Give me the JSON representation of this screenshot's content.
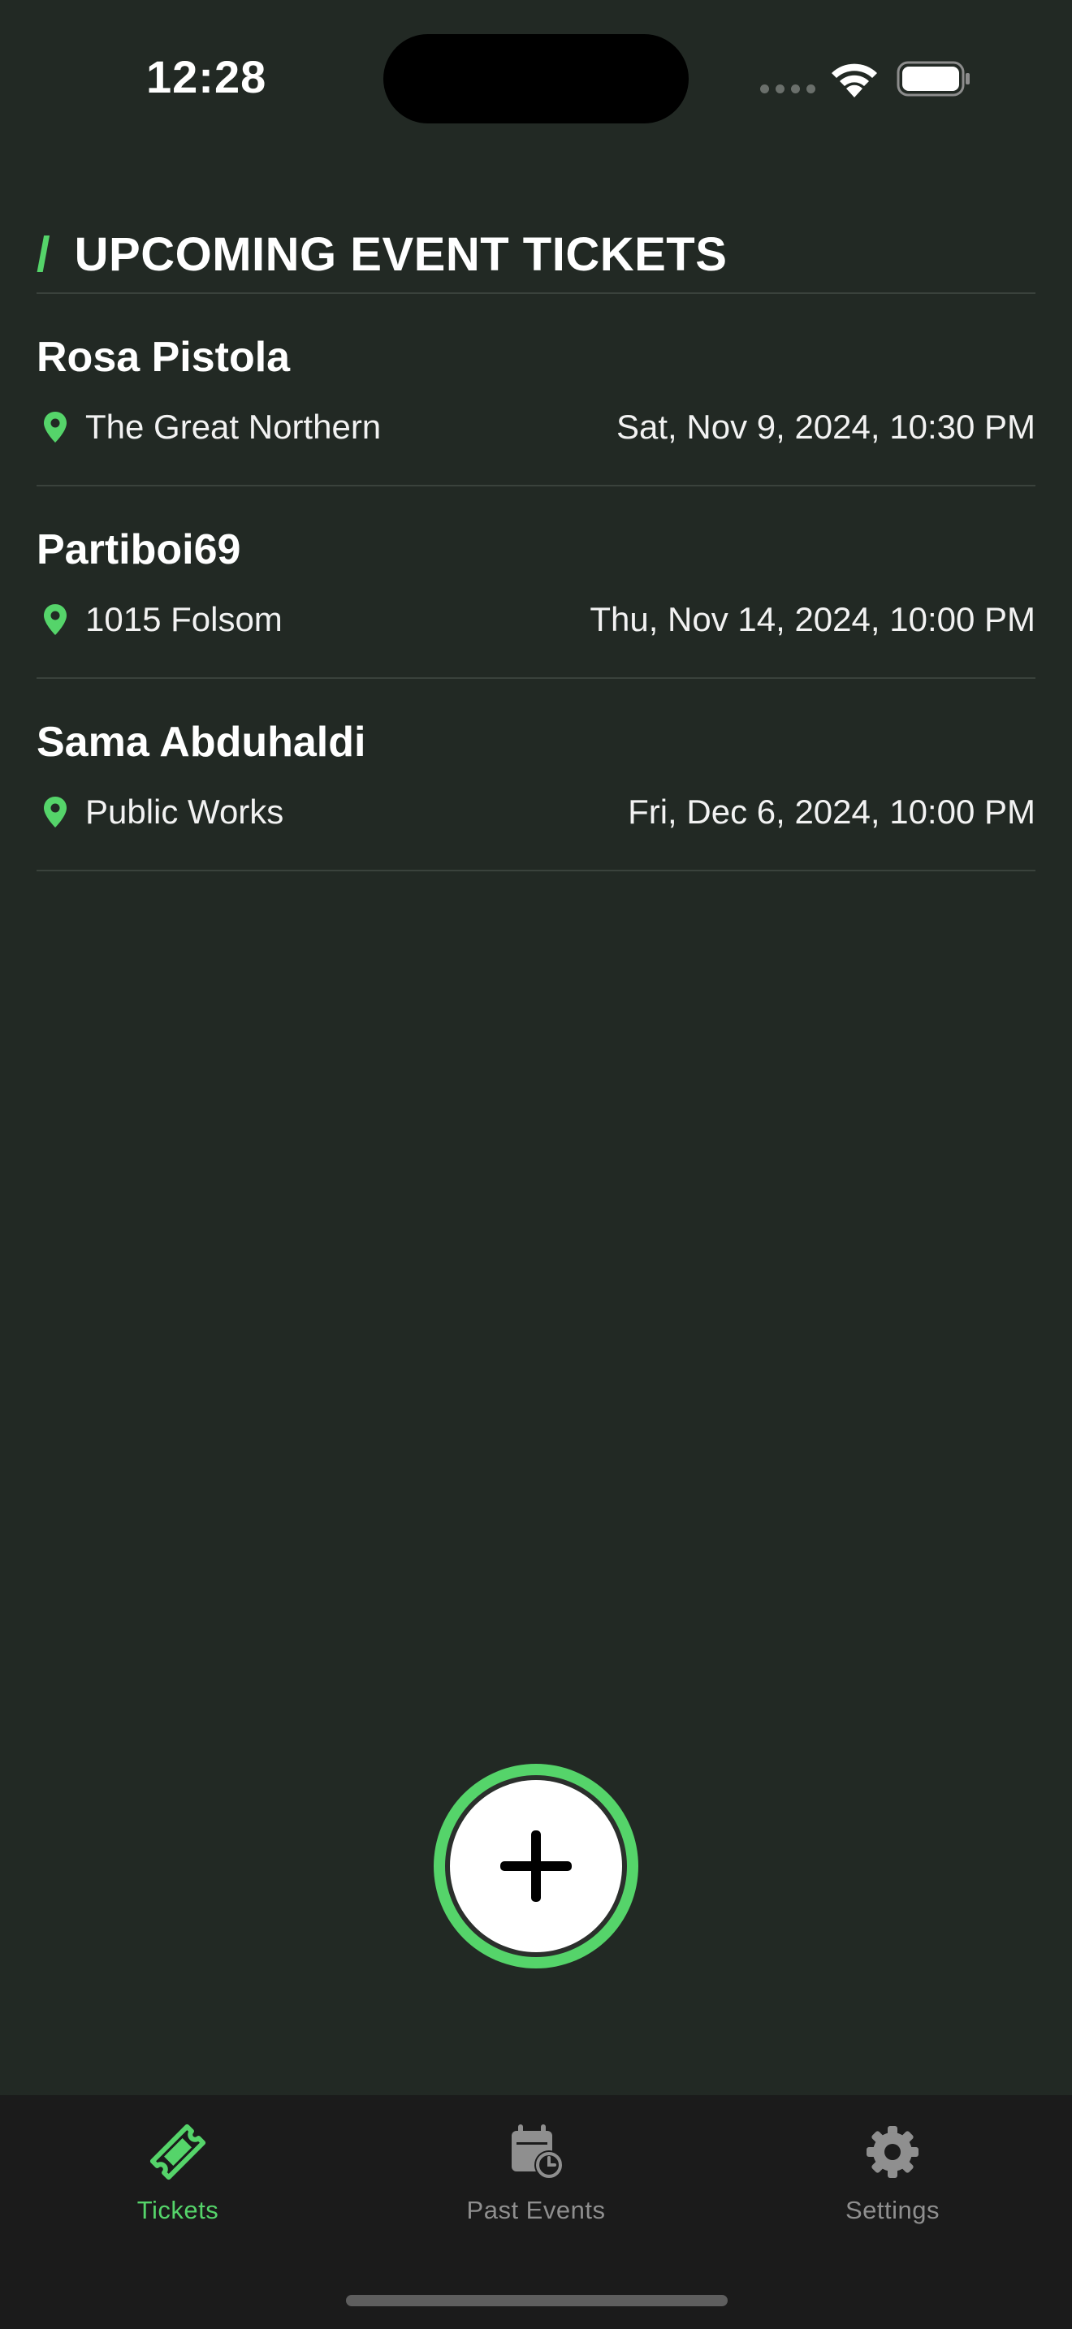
{
  "status_bar": {
    "time": "12:28"
  },
  "header": {
    "slash": "/",
    "title": "UPCOMING EVENT TICKETS"
  },
  "events": [
    {
      "name": "Rosa Pistola",
      "venue": "The Great Northern",
      "datetime": "Sat, Nov 9, 2024, 10:30 PM"
    },
    {
      "name": "Partiboi69",
      "venue": "1015 Folsom",
      "datetime": "Thu, Nov 14, 2024, 10:00 PM"
    },
    {
      "name": "Sama Abduhaldi",
      "venue": "Public Works",
      "datetime": "Fri, Dec 6, 2024, 10:00 PM"
    }
  ],
  "fab": {
    "icon": "plus-icon"
  },
  "tabbar": {
    "tickets": {
      "label": "Tickets",
      "icon": "ticket-icon"
    },
    "past_events": {
      "label": "Past Events",
      "icon": "calendar-clock-icon"
    },
    "settings": {
      "label": "Settings",
      "icon": "gear-icon"
    }
  },
  "colors": {
    "accent": "#55d46a",
    "background": "#222924",
    "tabbar": "#1b1b1b"
  }
}
